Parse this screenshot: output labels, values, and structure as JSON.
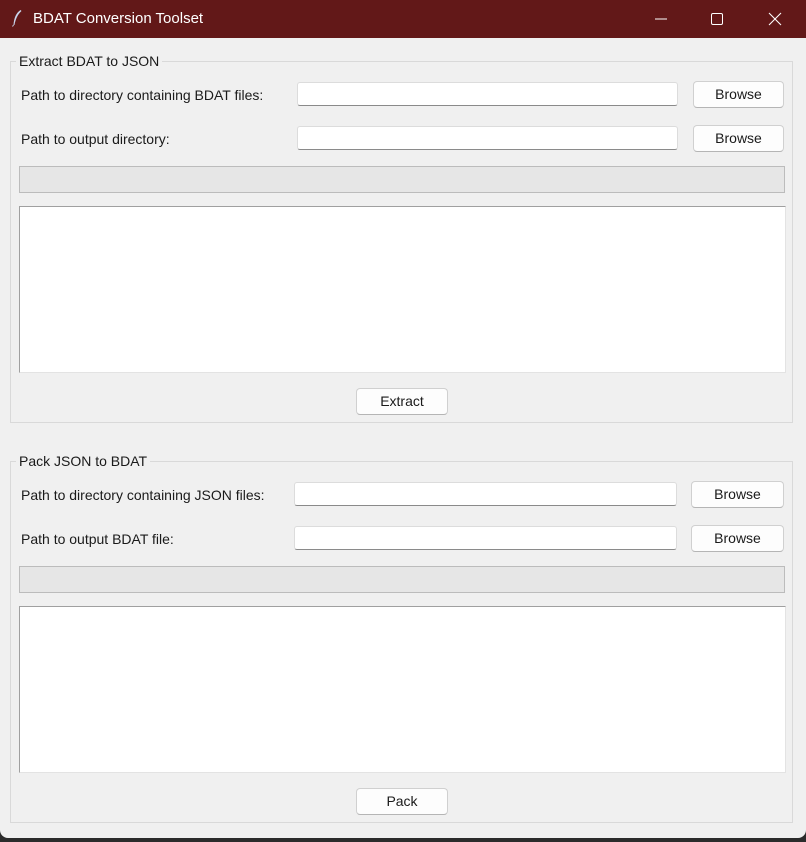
{
  "window": {
    "title": "BDAT Conversion Toolset",
    "titlebar_color": "#621818"
  },
  "extract": {
    "group_title": "Extract BDAT to JSON",
    "input_dir_label": "Path to directory containing BDAT files:",
    "input_dir_value": "",
    "output_dir_label": "Path to output directory:",
    "output_dir_value": "",
    "browse_label": "Browse",
    "progress": 0,
    "log": "",
    "action_label": "Extract"
  },
  "pack": {
    "group_title": "Pack JSON to BDAT",
    "input_dir_label": "Path to directory containing JSON files:",
    "input_dir_value": "",
    "output_file_label": "Path to output BDAT file:",
    "output_file_value": "",
    "browse_label": "Browse",
    "progress": 0,
    "log": "",
    "action_label": "Pack"
  },
  "icons": [
    "feather-icon",
    "minimize-icon",
    "maximize-icon",
    "close-icon"
  ]
}
